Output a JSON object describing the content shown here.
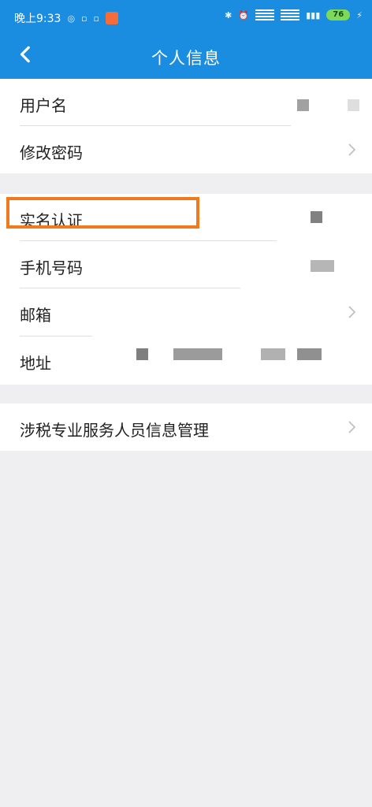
{
  "status": {
    "time": "晚上9:33",
    "battery": "76"
  },
  "header": {
    "title": "个人信息"
  },
  "sections": [
    {
      "items": [
        {
          "label": "用户名"
        },
        {
          "label": "修改密码"
        }
      ]
    },
    {
      "items": [
        {
          "label": "实名认证"
        },
        {
          "label": "手机号码"
        },
        {
          "label": "邮箱"
        },
        {
          "label": "地址"
        }
      ]
    },
    {
      "items": [
        {
          "label": "涉税专业服务人员信息管理"
        }
      ]
    }
  ],
  "colors": {
    "header": "#1b8de1",
    "background": "#efeff2",
    "highlight": "#f07b1f"
  }
}
